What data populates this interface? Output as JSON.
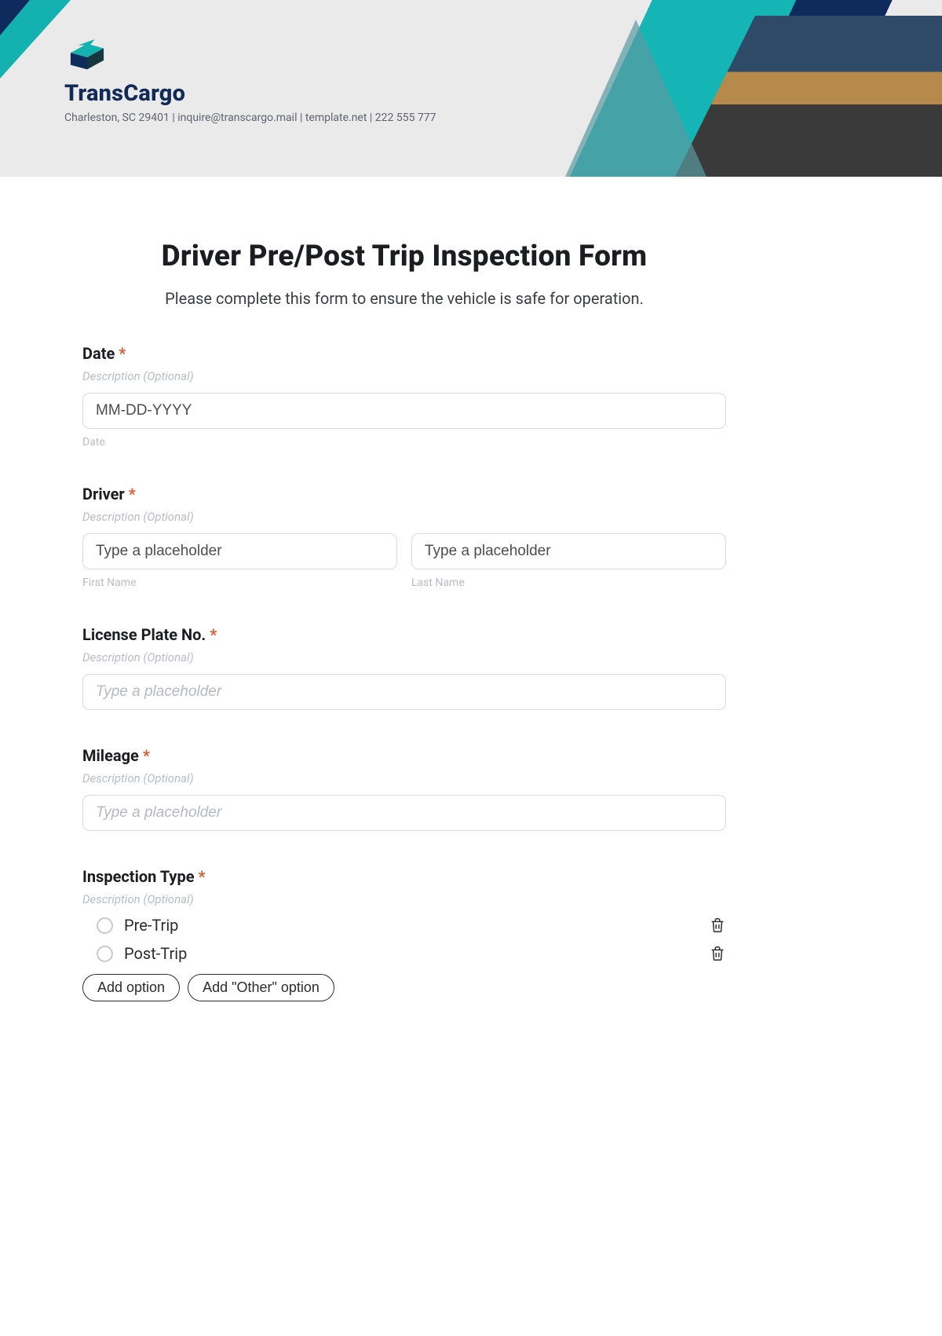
{
  "brand": {
    "name": "TransCargo",
    "info": "Charleston, SC 29401 | inquire@transcargo.mail | template.net | 222 555 777"
  },
  "form": {
    "title": "Driver Pre/Post Trip Inspection Form",
    "subtitle": "Please complete this form to ensure the vehicle is safe for operation.",
    "desc_placeholder": "Description (Optional)",
    "required_mark": "*",
    "date": {
      "label": "Date",
      "placeholder": "MM-DD-YYYY",
      "sublabel": "Date"
    },
    "driver": {
      "label": "Driver",
      "first_placeholder": "Type a placeholder",
      "last_placeholder": "Type a placeholder",
      "first_sub": "First Name",
      "last_sub": "Last Name"
    },
    "plate": {
      "label": "License Plate No.",
      "placeholder": "Type a placeholder"
    },
    "mileage": {
      "label": "Mileage",
      "placeholder": "Type a placeholder"
    },
    "inspection": {
      "label": "Inspection Type",
      "options": [
        "Pre-Trip",
        "Post-Trip"
      ],
      "add_option": "Add option",
      "add_other": "Add \"Other\" option"
    }
  }
}
